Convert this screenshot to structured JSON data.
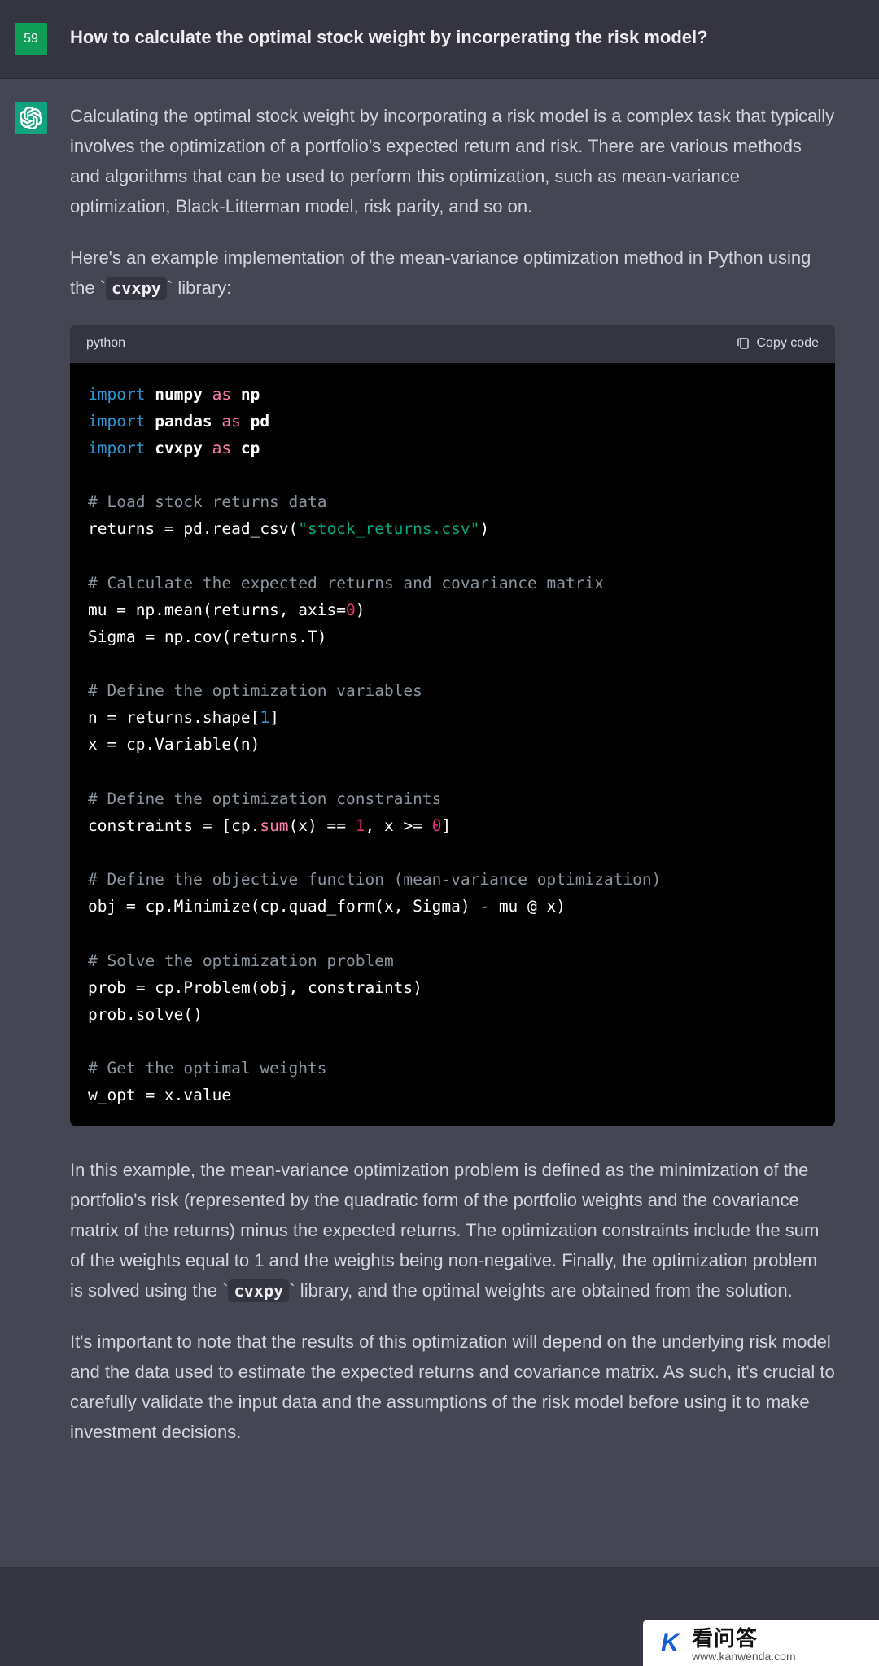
{
  "user": {
    "avatar_label": "59",
    "message": "How to calculate the optimal stock weight by incorperating the risk model?"
  },
  "assistant": {
    "p1": "Calculating the optimal stock weight by incorporating a risk model is a complex task that typically involves the optimization of a portfolio's expected return and risk. There are various methods and algorithms that can be used to perform this optimization, such as mean-variance optimization, Black-Litterman model, risk parity, and so on.",
    "p2_pre": "Here's an example implementation of the mean-variance optimization method in Python using the ",
    "p2_code": "cvxpy",
    "p2_post": " library:",
    "code": {
      "lang": "python",
      "copy_label": "Copy code",
      "tokens": {
        "kw_import": "import",
        "kw_as": "as",
        "mod_numpy": "numpy",
        "alias_np": "np",
        "mod_pandas": "pandas",
        "alias_pd": "pd",
        "mod_cvxpy": "cvxpy",
        "alias_cp": "cp",
        "c1": "# Load stock returns data",
        "l1a": "returns = pd.read_csv(",
        "l1s": "\"stock_returns.csv\"",
        "l1b": ")",
        "c2": "# Calculate the expected returns and covariance matrix",
        "l2a": "mu = np.mean(returns, axis=",
        "l2n": "0",
        "l2b": ")",
        "l3": "Sigma = np.cov(returns.T)",
        "c3": "# Define the optimization variables",
        "l4a": "n = returns.shape[",
        "l4n": "1",
        "l4b": "]",
        "l5": "x = cp.Variable(n)",
        "c4": "# Define the optimization constraints",
        "l6a": "constraints = [cp.",
        "l6sum": "sum",
        "l6b": "(x) == ",
        "l6n1": "1",
        "l6c": ", x >= ",
        "l6n0": "0",
        "l6d": "]",
        "c5": "# Define the objective function (mean-variance optimization)",
        "l7": "obj = cp.Minimize(cp.quad_form(x, Sigma) - mu @ x)",
        "c6": "# Solve the optimization problem",
        "l8": "prob = cp.Problem(obj, constraints)",
        "l9": "prob.solve()",
        "c7": "# Get the optimal weights",
        "l10": "w_opt = x.value"
      }
    },
    "p3_pre": "In this example, the mean-variance optimization problem is defined as the minimization of the portfolio's risk (represented by the quadratic form of the portfolio weights and the covariance matrix of the returns) minus the expected returns. The optimization constraints include the sum of the weights equal to 1 and the weights being non-negative. Finally, the optimization problem is solved using the ",
    "p3_code": "cvxpy",
    "p3_post": " library, and the optimal weights are obtained from the solution.",
    "p4": "It's important to note that the results of this optimization will depend on the underlying risk model and the data used to estimate the expected returns and covariance matrix. As such, it's crucial to carefully validate the input data and the assumptions of the risk model before using it to make investment decisions."
  },
  "watermark": {
    "title": "看问答",
    "url": "www.kanwenda.com"
  }
}
